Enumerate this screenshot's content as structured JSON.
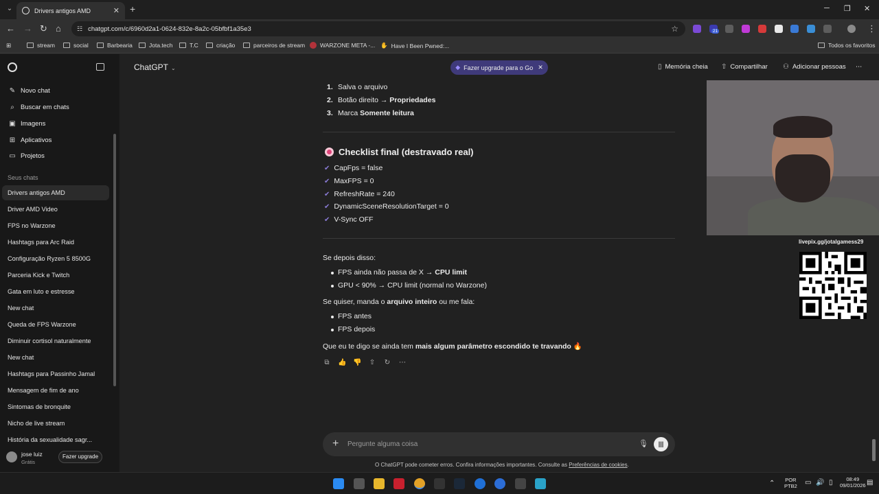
{
  "browser": {
    "tab_title": "Drivers antigos AMD",
    "url": "chatgpt.com/c/6960d2a1-0624-832e-8a2c-05bfbf1a35e3",
    "extension_badge": "21",
    "bookmarks": [
      "stream",
      "social",
      "Barbearia",
      "Jota.tech",
      "T.C",
      "criação",
      "parceiros de stream",
      "WARZONE META -...",
      "Have I Been Pwned:..."
    ],
    "all_bookmarks": "Todos os favoritos"
  },
  "sidebar": {
    "menu": [
      "Novo chat",
      "Buscar em chats",
      "Imagens",
      "Aplicativos",
      "Projetos"
    ],
    "section_label": "Seus chats",
    "chats": [
      "Drivers antigos AMD",
      "Driver AMD Video",
      "FPS no Warzone",
      "Hashtags para Arc Raid",
      "Configuração Ryzen 5 8500G",
      "Parceria Kick e Twitch",
      "Gata em luto e estresse",
      "New chat",
      "Queda de FPS Warzone",
      "Diminuir cortisol naturalmente",
      "New chat",
      "Hashtags para Passinho Jamal",
      "Mensagem de fim de ano",
      "Sintomas de bronquite",
      "Nicho de live stream",
      "História da sexualidade sagr..."
    ],
    "user_name": "jose luiz",
    "user_plan": "Grátis",
    "upgrade_label": "Fazer upgrade"
  },
  "header": {
    "model": "ChatGPT",
    "go_pill": "Fazer upgrade para o Go",
    "memory": "Memória cheia",
    "share": "Compartilhar",
    "add_people": "Adicionar pessoas"
  },
  "message": {
    "steps": [
      {
        "n": "1.",
        "text": "Salva o arquivo",
        "bold": ""
      },
      {
        "n": "2.",
        "text": "Botão direito → ",
        "bold": "Propriedades"
      },
      {
        "n": "3.",
        "text": "Marca ",
        "bold": "Somente leitura"
      }
    ],
    "checklist_title": "Checklist final (destravado real)",
    "checklist": [
      "CapFps = false",
      "MaxFPS = 0",
      "RefreshRate = 240",
      "DynamicSceneResolutionTarget = 0",
      "V-Sync OFF"
    ],
    "after_intro": "Se depois disso:",
    "after_bullets": [
      {
        "text": "FPS ainda não passa de X → ",
        "bold": "CPU limit"
      },
      {
        "text": "GPU < 90% → CPU limit (normal no Warzone)",
        "bold": ""
      }
    ],
    "send_pre": "Se quiser, manda o ",
    "send_bold": "arquivo inteiro",
    "send_post": " ou me fala:",
    "fps_bullets": [
      "FPS antes",
      "FPS depois"
    ],
    "closing_pre": "Que eu te digo se ainda tem ",
    "closing_bold": "mais algum parâmetro escondido te travando",
    "closing_emoji": "🔥"
  },
  "overlay": {
    "livepix": "livepix.gg/jotalgamess29"
  },
  "composer": {
    "placeholder": "Pergunte alguma coisa",
    "disclaimer_pre": "O ChatGPT pode cometer erros. Confira informações importantes. Consulte as ",
    "disclaimer_link": "Preferências de cookies",
    "disclaimer_post": "."
  },
  "taskbar": {
    "lang": "POR",
    "layout": "PTB2",
    "time": "08:49",
    "date": "09/01/2026"
  }
}
